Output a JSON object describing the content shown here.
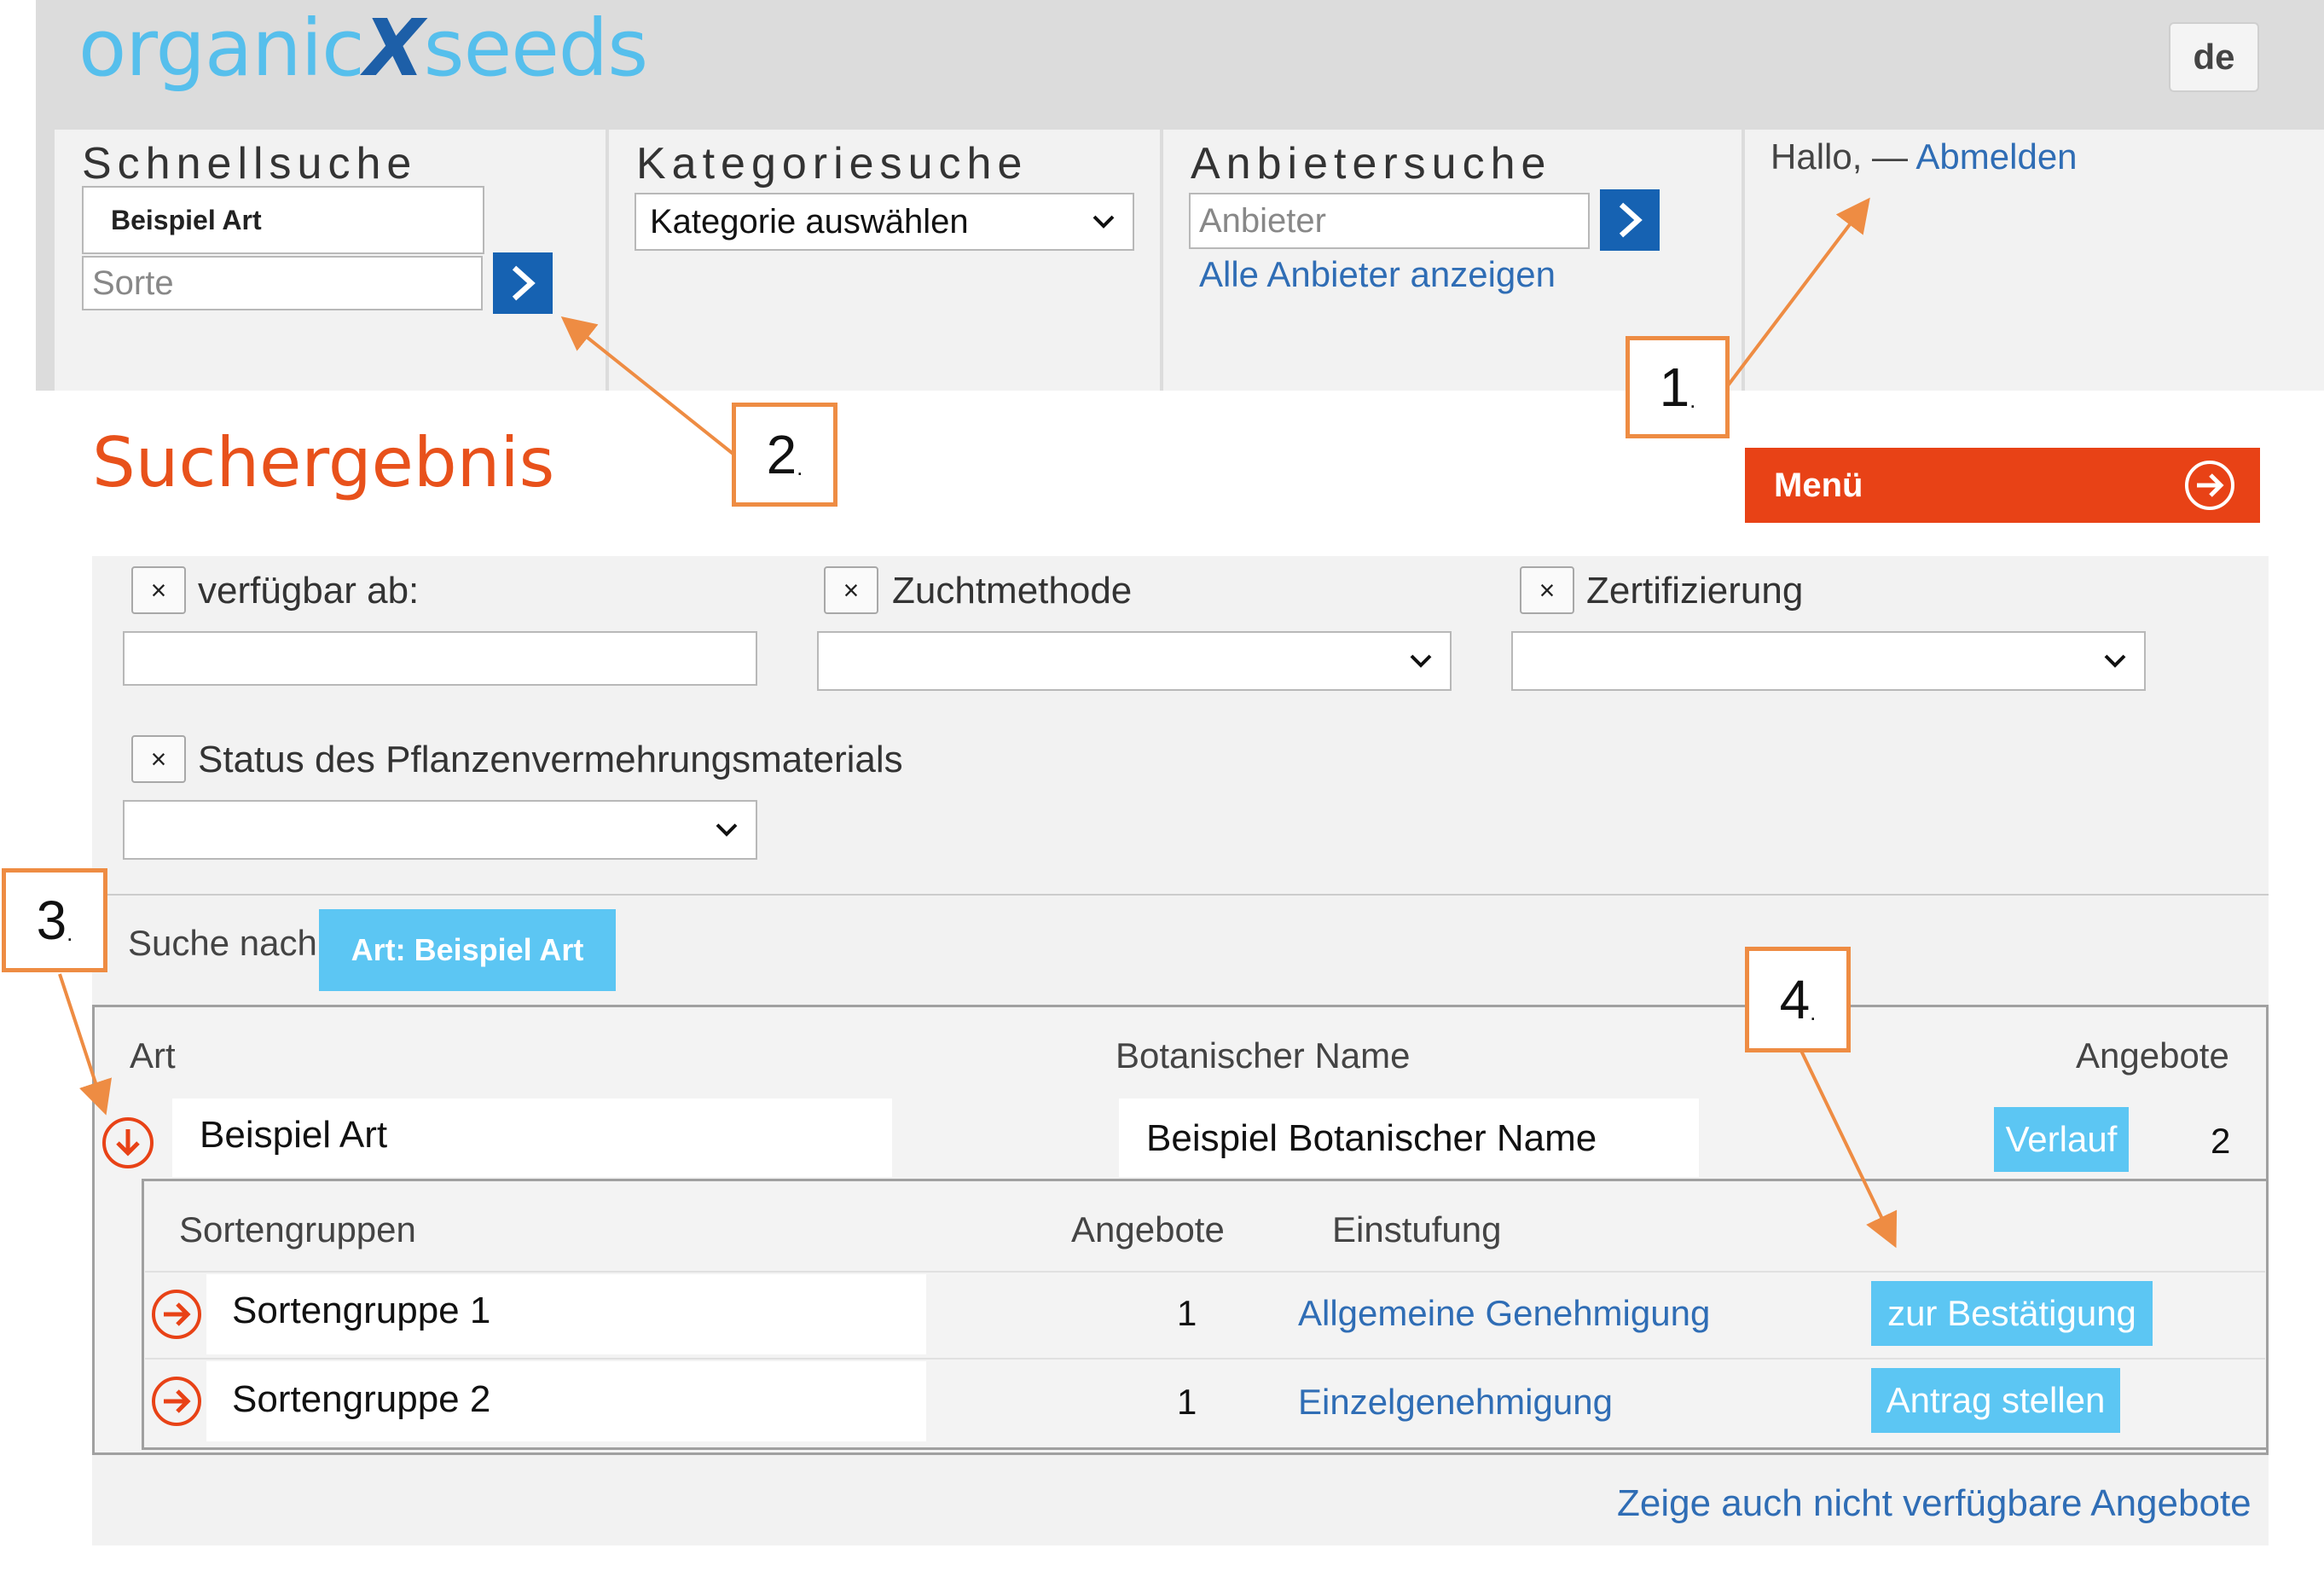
{
  "header": {
    "logo_part1": "organic",
    "logo_x": "X",
    "logo_part2": "seeds",
    "language": "de"
  },
  "quick_search": {
    "title": "Schnellsuche",
    "species_value": "Beispiel Art",
    "variety_placeholder": "Sorte"
  },
  "category_search": {
    "title": "Kategoriesuche",
    "selected": "Kategorie auswählen"
  },
  "provider_search": {
    "title": "Anbietersuche",
    "placeholder": "Anbieter",
    "show_all_link": "Alle Anbieter anzeigen"
  },
  "user": {
    "greeting": "Hallo, —",
    "logout_link": "Abmelden"
  },
  "main": {
    "page_title": "Suchergebnis",
    "menu_label": "Menü"
  },
  "filters": {
    "remove_symbol": "×",
    "available_from": "verfügbar ab:",
    "breeding_method": "Zuchtmethode",
    "certification": "Zertifizierung",
    "propagation_status": "Status des Pflanzenvermehrungsmaterials"
  },
  "search_for": {
    "label": "Suche nach",
    "tag": "Art: Beispiel Art"
  },
  "results": {
    "headers": {
      "species": "Art",
      "botanical_name": "Botanischer Name",
      "offers": "Angebote"
    },
    "row": {
      "species": "Beispiel Art",
      "botanical_name": "Beispiel Botanischer Name",
      "history_button": "Verlauf",
      "offers": "2"
    },
    "sub_headers": {
      "groups": "Sortengruppen",
      "offers": "Angebote",
      "rating": "Einstufung"
    },
    "sub_rows": [
      {
        "name": "Sortengruppe 1",
        "offers": "1",
        "rating": "Allgemeine Genehmigung",
        "action": "zur Bestätigung"
      },
      {
        "name": "Sortengruppe 2",
        "offers": "1",
        "rating": "Einzelgenehmigung",
        "action": "Antrag stellen"
      }
    ],
    "show_unavailable_link": "Zeige auch nicht verfügbare Angebote"
  },
  "annotations": {
    "a1": "1",
    "a2": "2",
    "a3": "3",
    "a4": "4",
    "dot": "."
  },
  "colors": {
    "header_bg": "#dcdcdc",
    "logo_light": "#56bfec",
    "logo_dark": "#1d5fa8",
    "go_button": "#1662b2",
    "accent_orange": "#e84216",
    "title_orange": "#e8511b",
    "button_light_blue": "#5cc6f3",
    "link_blue": "#2f6db5",
    "annotation_orange": "#ee8c43"
  },
  "icons": {
    "go": "chevron-right-icon",
    "select": "chevron-down-icon",
    "menu": "circle-arrow-right-icon",
    "expanded_row": "circle-arrow-down-icon",
    "collapsed_row": "circle-arrow-right-icon"
  }
}
